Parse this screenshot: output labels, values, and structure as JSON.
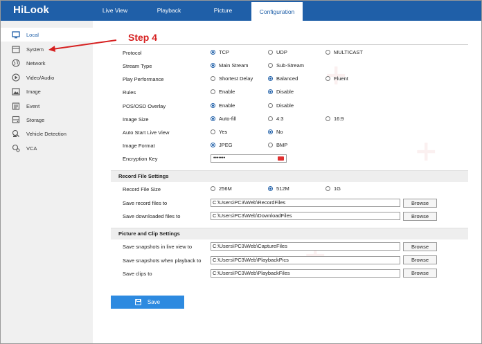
{
  "app": {
    "logo": "HiLook"
  },
  "nav": {
    "tabs": [
      {
        "label": "Live View"
      },
      {
        "label": "Playback"
      },
      {
        "label": "Picture"
      },
      {
        "label": "Configuration",
        "active": true
      }
    ]
  },
  "sidebar": {
    "items": [
      {
        "label": "Local",
        "icon": "monitor-icon",
        "active": true
      },
      {
        "label": "System",
        "icon": "system-icon"
      },
      {
        "label": "Network",
        "icon": "globe-icon"
      },
      {
        "label": "Video/Audio",
        "icon": "video-icon"
      },
      {
        "label": "Image",
        "icon": "image-icon"
      },
      {
        "label": "Event",
        "icon": "event-icon"
      },
      {
        "label": "Storage",
        "icon": "storage-icon"
      },
      {
        "label": "Vehicle Detection",
        "icon": "vehicle-icon"
      },
      {
        "label": "VCA",
        "icon": "vca-icon"
      }
    ]
  },
  "annotation": {
    "step": "Step 4"
  },
  "live_view": {
    "protocol": {
      "label": "Protocol",
      "options": [
        "TCP",
        "UDP",
        "MULTICAST"
      ],
      "selected": "TCP"
    },
    "stream_type": {
      "label": "Stream Type",
      "options": [
        "Main Stream",
        "Sub-Stream"
      ],
      "selected": "Main Stream"
    },
    "play_performance": {
      "label": "Play Performance",
      "options": [
        "Shortest Delay",
        "Balanced",
        "Fluent"
      ],
      "selected": "Balanced"
    },
    "rules": {
      "label": "Rules",
      "options": [
        "Enable",
        "Disable"
      ],
      "selected": "Disable"
    },
    "pos_osd": {
      "label": "POS/OSD Overlay",
      "options": [
        "Enable",
        "Disable"
      ],
      "selected": "Enable"
    },
    "image_size": {
      "label": "Image Size",
      "options": [
        "Auto-fill",
        "4:3",
        "16:9"
      ],
      "selected": "Auto-fill"
    },
    "auto_start": {
      "label": "Auto Start Live View",
      "options": [
        "Yes",
        "No"
      ],
      "selected": "No"
    },
    "image_format": {
      "label": "Image Format",
      "options": [
        "JPEG",
        "BMP"
      ],
      "selected": "JPEG"
    },
    "encryption_key": {
      "label": "Encryption Key",
      "value": "•••••••"
    }
  },
  "record": {
    "title": "Record File Settings",
    "size": {
      "label": "Record File Size",
      "options": [
        "256M",
        "512M",
        "1G"
      ],
      "selected": "512M"
    },
    "save_record": {
      "label": "Save record files to",
      "value": "C:\\Users\\PC3\\Web\\RecordFiles"
    },
    "save_download": {
      "label": "Save downloaded files to",
      "value": "C:\\Users\\PC3\\Web\\DownloadFiles"
    }
  },
  "picture": {
    "title": "Picture and Clip Settings",
    "snap_live": {
      "label": "Save snapshots in live view to",
      "value": "C:\\Users\\PC3\\Web\\CaptureFiles"
    },
    "snap_playback": {
      "label": "Save snapshots when playback to",
      "value": "C:\\Users\\PC3\\Web\\PlaybackPics"
    },
    "clips": {
      "label": "Save clips to",
      "value": "C:\\Users\\PC3\\Web\\PlaybackFiles"
    }
  },
  "browse_label": "Browse",
  "save_label": "Save",
  "colors": {
    "brand": "#1f5fa8",
    "save": "#2d8ae0",
    "annotation": "#d62020"
  }
}
